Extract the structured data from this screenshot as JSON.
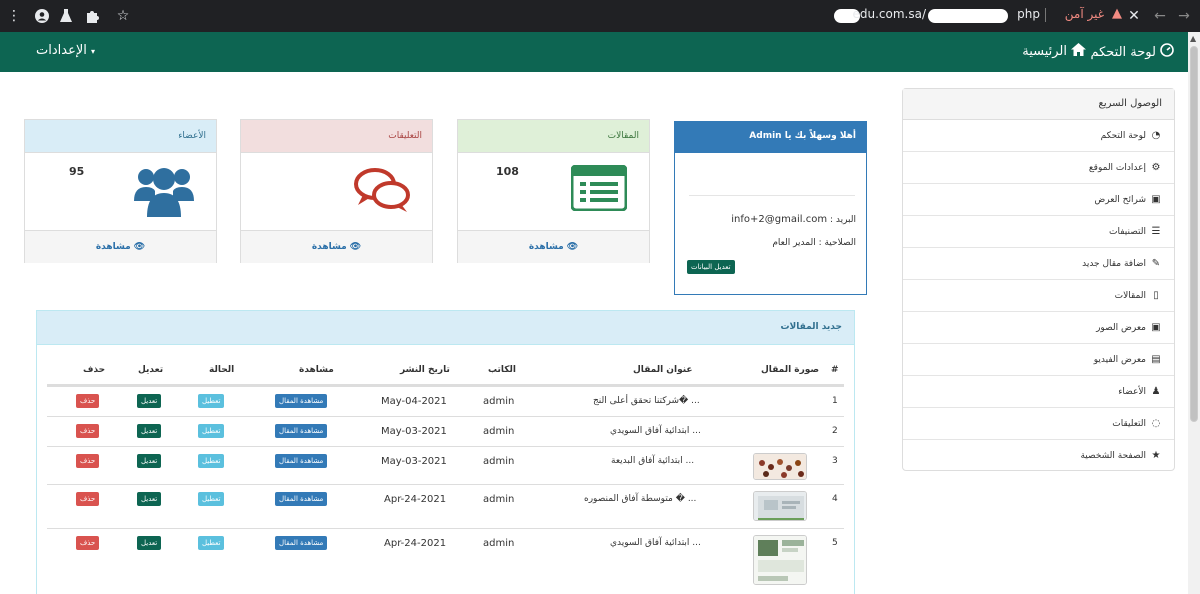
{
  "browser": {
    "url_fragment_1": "edu.com.sa/",
    "url_fragment_2": "php",
    "insecure_label": "غير آمن"
  },
  "navbar": {
    "brand": "لوحة التحكم",
    "home": "الرئيسية",
    "settings": "الإعدادات"
  },
  "sidebar": {
    "title": "الوصول السريع",
    "items": [
      {
        "label": "لوحة التحكم",
        "icon": "dashboard-icon"
      },
      {
        "label": "إعدادات الموقع",
        "icon": "gear-icon"
      },
      {
        "label": "شرائح العرض",
        "icon": "image-icon"
      },
      {
        "label": "التصنيفات",
        "icon": "list-icon"
      },
      {
        "label": "اضافة مقال جديد",
        "icon": "pencil-icon"
      },
      {
        "label": "المقالات",
        "icon": "file-icon"
      },
      {
        "label": "معرض الصور",
        "icon": "image-icon"
      },
      {
        "label": "معرض الفيديو",
        "icon": "video-file-icon"
      },
      {
        "label": "الأعضاء",
        "icon": "user-icon"
      },
      {
        "label": "التعليقات",
        "icon": "comments-icon"
      },
      {
        "label": "الصفحة الشخصية",
        "icon": "star-icon"
      }
    ]
  },
  "welcome": {
    "title": "أهلا وسهلاً بك يا Admin",
    "email_label": "البريد :",
    "email_value": "info+2@gmail.com",
    "role": "الصلاحية : المدير العام",
    "edit_button": "تعديل البيانات"
  },
  "cards": {
    "members": {
      "title": "الأعضاء",
      "count": "95",
      "view": "مشاهدة",
      "color": "#d9edf7",
      "text_color": "#31708f",
      "icon": "users-icon"
    },
    "comments": {
      "title": "التعليقات",
      "count": "",
      "view": "مشاهدة",
      "color": "#f2dede",
      "text_color": "#a94442",
      "icon": "comments-icon"
    },
    "articles": {
      "title": "المقالات",
      "count": "108",
      "view": "مشاهدة",
      "color": "#dff0d8",
      "text_color": "#3c763d",
      "icon": "list-alt-icon"
    }
  },
  "latest": {
    "title": "جديد المقالات",
    "headers": {
      "num": "#",
      "image": "صورة المقال",
      "title": "عنوان المقال",
      "author": "الكاتب",
      "date": "تاريخ النشر",
      "view": "مشاهدة",
      "state": "الحالة",
      "edit": "تعديل",
      "delete": "حذف"
    },
    "rows": [
      {
        "num": "1",
        "title": "شركتنا تحقق أعلى النج� ...",
        "author": "admin",
        "date": "May-04-2021",
        "view": "مشاهدة المقال",
        "state": "تعطيل",
        "edit": "تعديل",
        "delete": "حذف",
        "has_image": false
      },
      {
        "num": "2",
        "title": "ابتدائية آفاق السويدي ...",
        "author": "admin",
        "date": "May-03-2021",
        "view": "مشاهدة المقال",
        "state": "تعطيل",
        "edit": "تعديل",
        "delete": "حذف",
        "has_image": false
      },
      {
        "num": "3",
        "title": "ابتدائية آفاق البديعة ...",
        "author": "admin",
        "date": "May-03-2021",
        "view": "مشاهدة المقال",
        "state": "تعطيل",
        "edit": "تعديل",
        "delete": "حذف",
        "has_image": true
      },
      {
        "num": "4",
        "title": "متوسطة آفاق المنصوره � ...",
        "author": "admin",
        "date": "Apr-24-2021",
        "view": "مشاهدة المقال",
        "state": "تعطيل",
        "edit": "تعديل",
        "delete": "حذف",
        "has_image": true
      },
      {
        "num": "5",
        "title": "ابتدائية آفاق السويدي ...",
        "author": "admin",
        "date": "Apr-24-2021",
        "view": "مشاهدة المقال",
        "state": "تعطيل",
        "edit": "تعديل",
        "delete": "حذف",
        "has_image": true
      }
    ]
  }
}
